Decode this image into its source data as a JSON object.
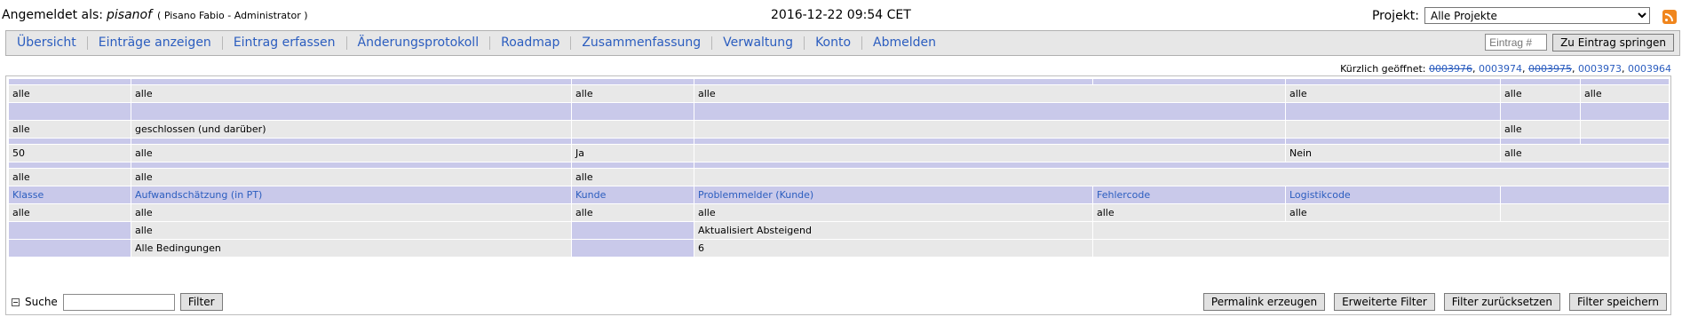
{
  "header": {
    "login_label": "Angemeldet als:",
    "username": "pisanof",
    "role": "( Pisano Fabio - Administrator )",
    "datetime": "2016-12-22 09:54 CET",
    "project_label": "Projekt:",
    "project_value": "Alle Projekte",
    "rss_icon": "rss-icon"
  },
  "menu": {
    "items": [
      "Übersicht",
      "Einträge anzeigen",
      "Eintrag erfassen",
      "Änderungsprotokoll",
      "Roadmap",
      "Zusammenfassung",
      "Verwaltung",
      "Konto",
      "Abmelden"
    ],
    "jump_placeholder": "Eintrag #",
    "jump_button": "Zu Eintrag springen"
  },
  "recent": {
    "label": "Kürzlich geöffnet:",
    "items": [
      "0003976",
      "0003974",
      "0003975",
      "0003973",
      "0003964"
    ]
  },
  "filters": {
    "row1": [
      "alle",
      "alle",
      "alle",
      "alle",
      "alle",
      "alle",
      "alle"
    ],
    "row2": [
      "alle",
      "geschlossen (und darüber)",
      "alle"
    ],
    "row3": [
      "50",
      "alle",
      "Ja",
      "Nein",
      "alle"
    ],
    "row4": [
      "alle",
      "alle",
      "alle"
    ],
    "custom_labels": [
      "Klasse",
      "Aufwandschätzung (in PT)",
      "Kunde",
      "Problemmelder (Kunde)",
      "Fehlercode",
      "Logistikcode"
    ],
    "custom_values": [
      "alle",
      "alle",
      "alle",
      "alle",
      "alle",
      "alle"
    ],
    "row7": [
      "alle",
      "Aktualisiert Absteigend"
    ],
    "row8": [
      "Alle Bedingungen",
      "6"
    ]
  },
  "bottom": {
    "search_label": "Suche",
    "filter_button": "Filter",
    "permalink_button": "Permalink erzeugen",
    "advanced_button": "Erweiterte Filter",
    "reset_button": "Filter zurücksetzen",
    "save_button": "Filter speichern"
  }
}
